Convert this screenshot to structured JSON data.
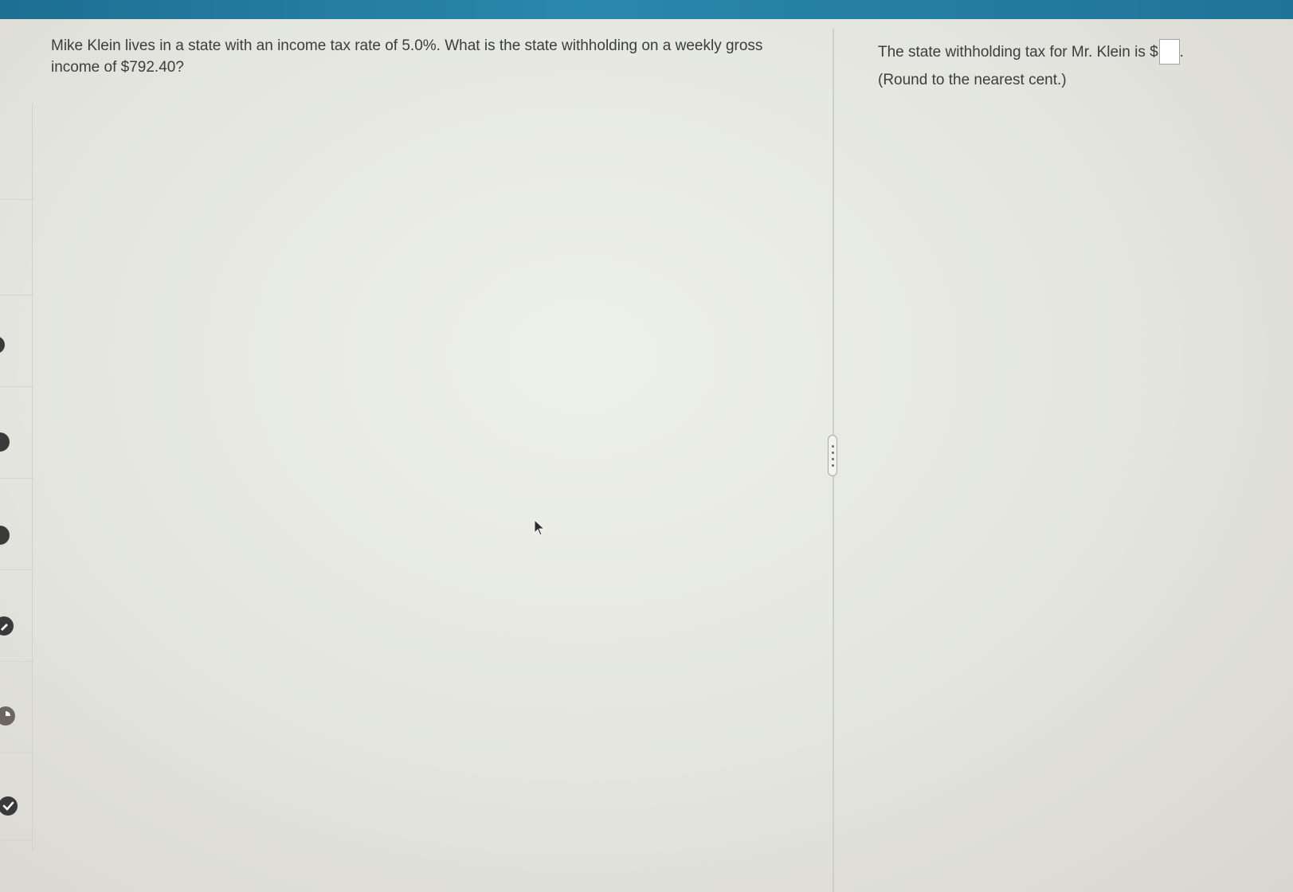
{
  "question": {
    "text": "Mike Klein lives in a state with an income tax rate of 5.0%. What is the state withholding on a weekly gross income of $792.40?"
  },
  "answer": {
    "prefix": "The state withholding tax for Mr. Klein is $",
    "value": "",
    "suffix": ".",
    "hint": "(Round to the nearest cent.)"
  },
  "colors": {
    "top_bar": "#1d6f93",
    "background": "#e6e7e1",
    "text": "#3d3d3d"
  },
  "icons": {
    "rail_status": [
      "status-icon",
      "status-icon",
      "status-icon",
      "status-icon",
      "partial-icon",
      "check-icon"
    ],
    "resize_handle": "vertical-ellipsis-icon",
    "pointer": "mouse-cursor-icon"
  }
}
